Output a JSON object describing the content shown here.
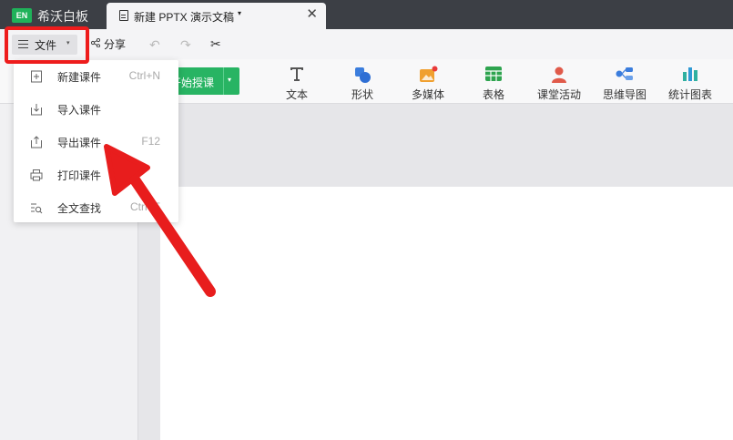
{
  "app": {
    "logo_text": "EN",
    "title": "希沃白板"
  },
  "tab": {
    "name": "新建 PPTX 演示文稿",
    "caret": "▾",
    "close": "✕"
  },
  "quickbar": {
    "file_label": "文件",
    "file_caret": "▾",
    "share_label": "分享"
  },
  "ribbon": {
    "start_label": "开始授课",
    "tools": [
      {
        "label": "文本",
        "icon": "text-icon",
        "color": "#555555"
      },
      {
        "label": "形状",
        "icon": "shape-icon",
        "color": "#3b7ddd"
      },
      {
        "label": "多媒体",
        "icon": "media-icon",
        "color": "#f0a030"
      },
      {
        "label": "表格",
        "icon": "table-icon",
        "color": "#2ea44f"
      },
      {
        "label": "课堂活动",
        "icon": "activity-icon",
        "color": "#e05a4a"
      },
      {
        "label": "思维导图",
        "icon": "mindmap-icon",
        "color": "#3b7ddd"
      },
      {
        "label": "统计图表",
        "icon": "chart-icon",
        "color": "#2fb0a0"
      }
    ]
  },
  "menu": {
    "items": [
      {
        "label": "新建课件",
        "shortcut": "Ctrl+N",
        "icon": "new-file-icon"
      },
      {
        "label": "导入课件",
        "shortcut": "",
        "icon": "import-icon"
      },
      {
        "label": "导出课件",
        "shortcut": "F12",
        "icon": "export-icon"
      },
      {
        "label": "打印课件",
        "shortcut": "",
        "icon": "print-icon"
      },
      {
        "label": "全文查找",
        "shortcut": "Ctrl+F",
        "icon": "search-text-icon"
      }
    ]
  },
  "colors": {
    "accent_green": "#28b463",
    "highlight_red": "#ee1c1c",
    "titlebar": "#3c3f45"
  }
}
